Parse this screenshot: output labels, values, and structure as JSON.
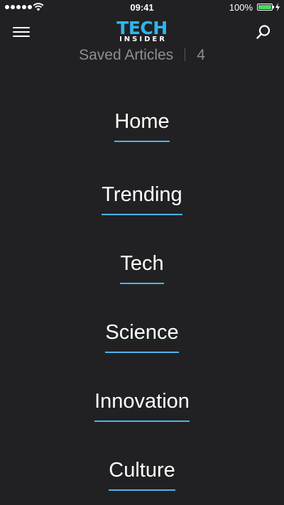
{
  "status_bar": {
    "time": "09:41",
    "battery_percent": "100%",
    "signal_bars": 5
  },
  "header": {
    "logo_main": "TECH",
    "logo_sub": "INSIDER",
    "logo_color": "#2eb6f0",
    "menu_icon": "hamburger-menu-icon",
    "search_icon": "search-icon"
  },
  "saved": {
    "label": "Saved Articles",
    "count": "4"
  },
  "nav": {
    "items": [
      {
        "label": "Home"
      },
      {
        "label": "Trending"
      },
      {
        "label": "Tech"
      },
      {
        "label": "Science"
      },
      {
        "label": "Innovation"
      },
      {
        "label": "Culture"
      }
    ],
    "underline_color": "#4fb3e8"
  },
  "colors": {
    "background": "#212123",
    "muted_text": "#8e8e92",
    "battery": "#4cd964"
  }
}
